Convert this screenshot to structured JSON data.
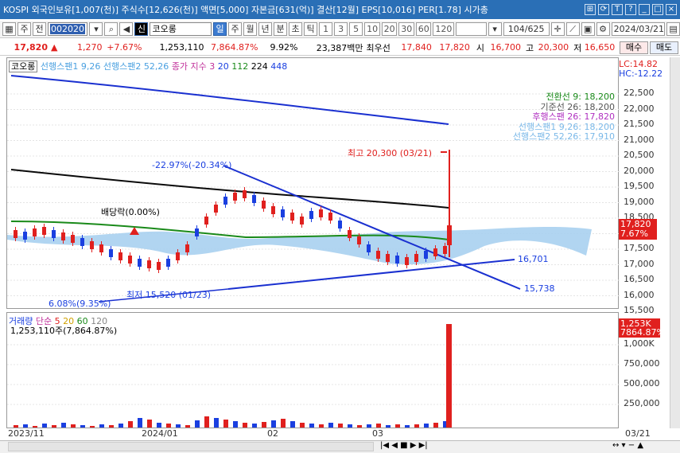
{
  "titlebar": {
    "text": "KOSPI 외국인보유[1,007(천)] 주식수[12,626(천)] 액면[5,000] 자본금[631(억)] 결산[12월] EPS[10,016] PER[1.78] 시가총"
  },
  "toolbar": {
    "type_label": "주",
    "prev_label": "전",
    "code": "002020",
    "name_prefix": "신",
    "name": "코오롱",
    "periods": [
      "일",
      "주",
      "월",
      "년",
      "분",
      "초",
      "틱"
    ],
    "intervals": [
      "1",
      "3",
      "5",
      "10",
      "20",
      "30",
      "60",
      "120"
    ],
    "page": "104/625",
    "date": "2024/03/21"
  },
  "quote": {
    "price": "17,820",
    "arrow": "▲",
    "change": "1,270",
    "pct": "+7.67%",
    "volume": "1,253,110",
    "vol_pct": "7,864.87%",
    "vol_ratio": "9.92%",
    "amount": "23,387백만",
    "best_label": "최우선",
    "best_ask": "17,840",
    "best_bid": "17,820",
    "open_label": "시",
    "open": "16,700",
    "high_label": "고",
    "high": "20,300",
    "low_label": "저",
    "low": "16,650",
    "buy_label": "매수",
    "sell_label": "매도"
  },
  "chart": {
    "legend": {
      "name": "코오롱",
      "lead1": "선행스팬1 9,26",
      "lead2": "선행스팬2 52,26",
      "ma_label": "종가 지수 3",
      "ma1": "20",
      "ma2": "112",
      "ma3": "224",
      "ma4": "448"
    },
    "lc": "LC:14.82",
    "hc": "HC:-12.22",
    "ichimoku": [
      "전환선 9: 18,200",
      "기준선 26: 18,200",
      "후행스팬 26: 17,820",
      "선행스팬1 9,26: 18,200",
      "선행스팬2 52,26: 17,910"
    ],
    "annot": {
      "high": "최고 20,300 (03/21)",
      "low": "최저 15,520 (01/23)",
      "div": "배당락(0.00%)",
      "pct1": "-22.97%(-20.34%)",
      "pct2": "6.08%(9.35%)",
      "t1": "16,701",
      "t2": "15,738"
    },
    "ticks": [
      "22,500",
      "22,000",
      "21,500",
      "21,000",
      "20,500",
      "20,000",
      "19,500",
      "19,000",
      "18,500",
      "18,000",
      "17,500",
      "17,000",
      "16,500",
      "16,000",
      "15,500"
    ],
    "price_tag": "17,820",
    "price_pct": "7.67%",
    "colors": {
      "up": "#e0201e",
      "down": "#1a3fe0",
      "ma112": "#0a0a0a",
      "ma224": "#1a8a1a",
      "cloud": "#a8d0f0",
      "trend": "#1a30d0"
    }
  },
  "chart_data": {
    "type": "candlestick",
    "x": [
      "2023/11",
      "2024/01",
      "02",
      "03",
      "03/21"
    ],
    "high": 20300,
    "low": 15520,
    "last": 17820,
    "ylim": [
      15500,
      22500
    ]
  },
  "volume": {
    "legend": {
      "name": "거래량",
      "simple": "단순",
      "m1": "5",
      "m2": "20",
      "m3": "60",
      "m4": "120"
    },
    "value": "1,253,110주(7,864.87%)",
    "tag": "1,253K",
    "tag_pct": "7864.87%",
    "ticks": [
      "1,000K",
      "750,000",
      "500,000",
      "250,000"
    ]
  },
  "xaxis": [
    "2023/11",
    "2024/01",
    "02",
    "03",
    "03/21"
  ]
}
